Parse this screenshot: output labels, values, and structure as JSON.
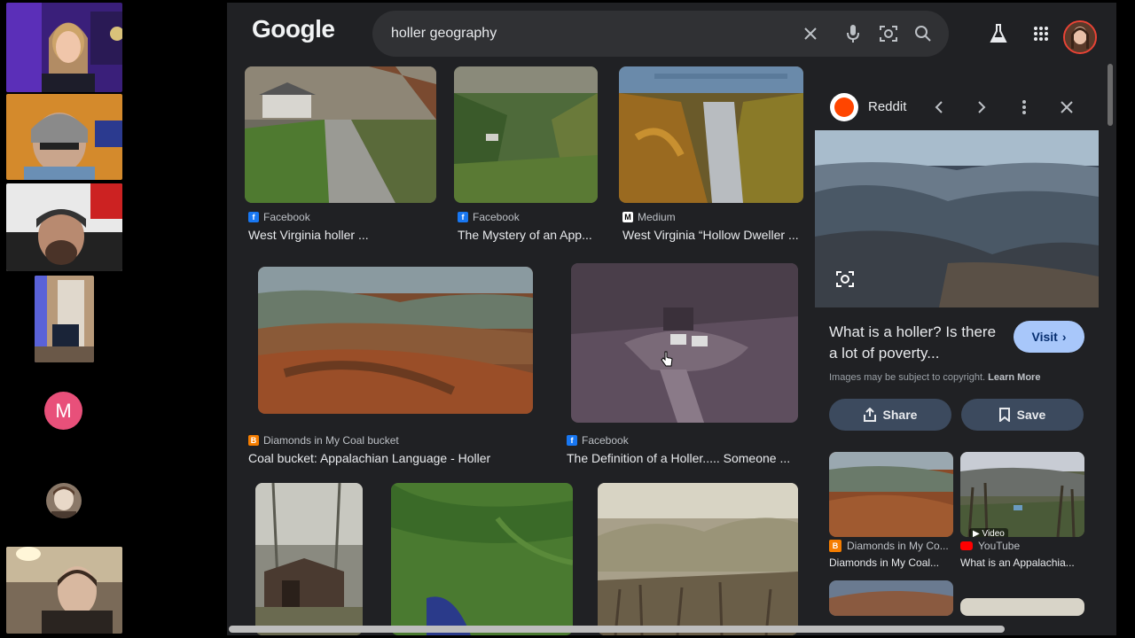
{
  "participants": {
    "initial_avatar": "M"
  },
  "google": {
    "logo_text": "Google",
    "search": {
      "value": "holler geography"
    },
    "results": [
      {
        "source": "Facebook",
        "title": "West Virginia holler ..."
      },
      {
        "source": "Facebook",
        "title": "The Mystery of an App..."
      },
      {
        "source": "Medium",
        "title": "West Virginia “Hollow Dweller ..."
      },
      {
        "source": "Diamonds in My Coal bucket",
        "title": "Coal bucket: Appalachian Language - Holler"
      },
      {
        "source": "Facebook",
        "title": "The Definition of a Holler..... Someone ..."
      }
    ],
    "panel": {
      "source_name": "Reddit",
      "title": "What is a holler? Is there a lot of poverty...",
      "visit_label": "Visit",
      "copyright_text": "Images may be subject to copyright.",
      "learn_more_label": "Learn More",
      "share_label": "Share",
      "save_label": "Save",
      "related": [
        {
          "source": "Diamonds in My Co...",
          "title": "Diamonds in My Coal..."
        },
        {
          "source": "YouTube",
          "title": "What is an Appalachia...",
          "badge": "Video"
        }
      ]
    }
  },
  "colors": {
    "background": "#202124",
    "visit_button": "#a8c7fa",
    "pill_button": "#3c4a5e",
    "reddit": "#ff4500",
    "youtube": "#ff0000",
    "facebook": "#1877f2",
    "blogger": "#f57d00"
  },
  "icons": [
    "clear-icon",
    "microphone-icon",
    "lens-icon",
    "search-icon",
    "labs-icon",
    "apps-grid-icon",
    "reddit-icon",
    "chevron-left-icon",
    "chevron-right-icon",
    "more-vert-icon",
    "close-icon",
    "share-icon",
    "bookmark-icon"
  ]
}
